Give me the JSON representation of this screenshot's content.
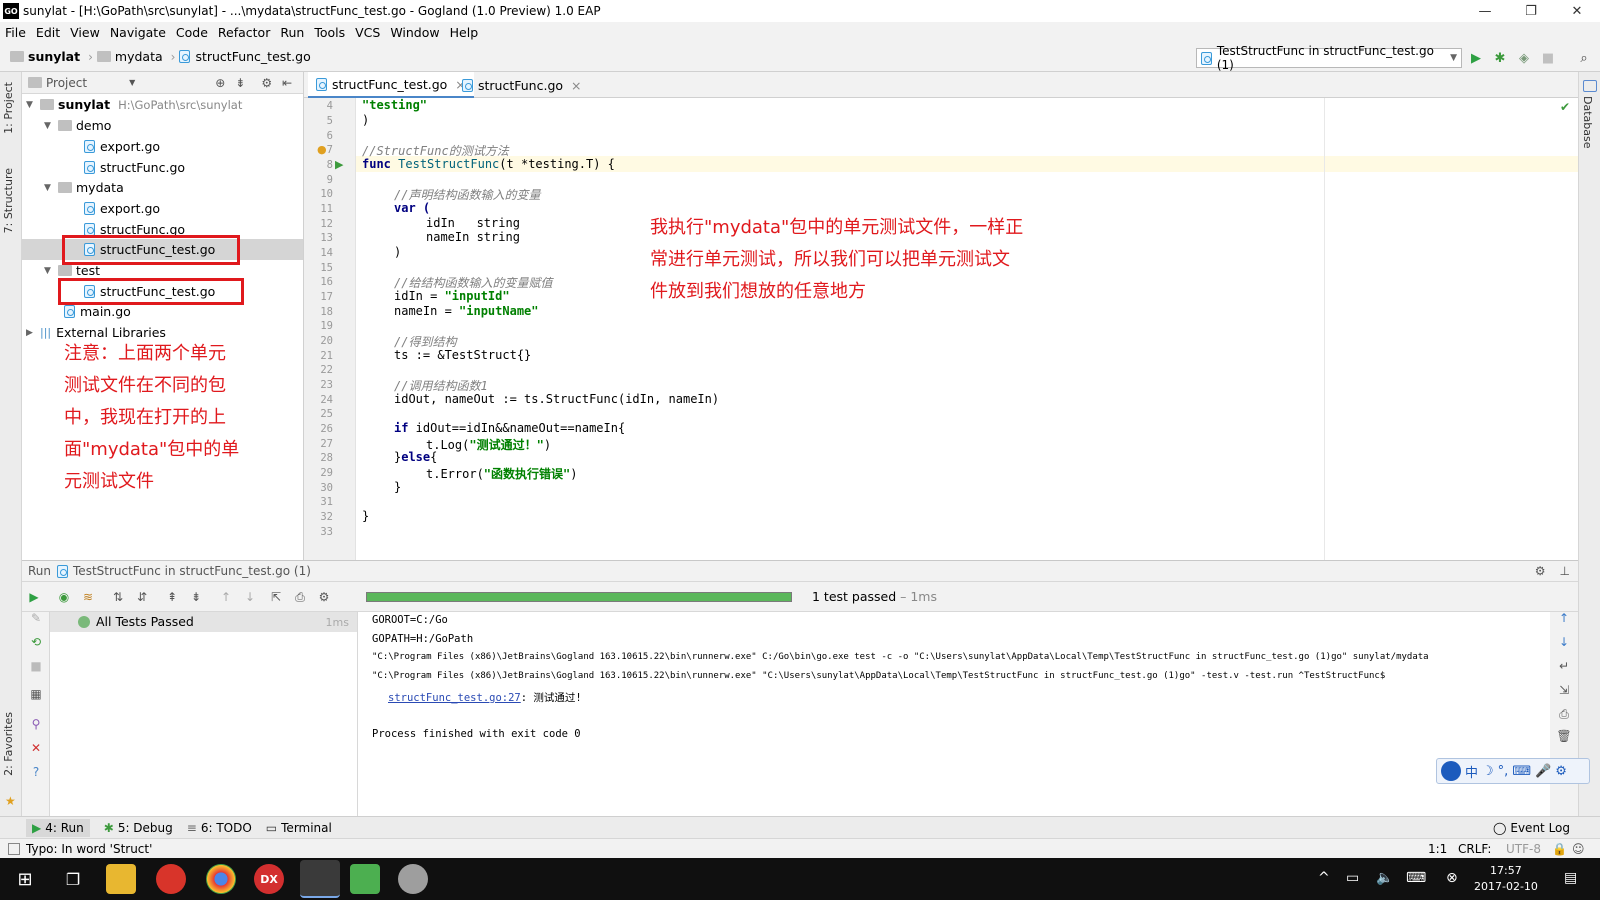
{
  "window": {
    "title": "sunylat - [H:\\GoPath\\src\\sunylat] - ...\\mydata\\structFunc_test.go - Gogland (1.0 Preview) 1.0 EAP",
    "app_icon": "GO"
  },
  "menu": [
    "File",
    "Edit",
    "View",
    "Navigate",
    "Code",
    "Refactor",
    "Run",
    "Tools",
    "VCS",
    "Window",
    "Help"
  ],
  "breadcrumb": {
    "project": "sunylat",
    "folder": "mydata",
    "file": "structFunc_test.go"
  },
  "run_config": {
    "label": "TestStructFunc in structFunc_test.go (1)"
  },
  "side_tabs": {
    "left_top": "1: Project",
    "left_mid": "7: Structure",
    "left_bottom": "2: Favorites",
    "right": "Database"
  },
  "project_panel": {
    "title": "Project",
    "tree": [
      {
        "label": "sunylat",
        "path": "H:\\GoPath\\src\\sunylat"
      },
      {
        "label": "demo"
      },
      {
        "label": "export.go"
      },
      {
        "label": "structFunc.go"
      },
      {
        "label": "mydata"
      },
      {
        "label": "export.go"
      },
      {
        "label": "structFunc.go"
      },
      {
        "label": "structFunc_test.go"
      },
      {
        "label": "test"
      },
      {
        "label": "structFunc_test.go"
      },
      {
        "label": "main.go"
      },
      {
        "label": "External Libraries"
      }
    ]
  },
  "annotations": {
    "left_note": [
      "注意：上面两个单元",
      "测试文件在不同的包",
      "中，我现在打开的上",
      "面\"mydata\"包中的单",
      "元测试文件"
    ],
    "right_note": [
      "我执行\"mydata\"包中的单元测试文件，一样正",
      "常进行单元测试，所以我们可以把单元测试文",
      "件放到我们想放的任意地方"
    ]
  },
  "editor": {
    "tabs": [
      "structFunc_test.go",
      "structFunc.go"
    ],
    "line_numbers": [
      "4",
      "5",
      "6",
      "7",
      "8",
      "9",
      "10",
      "11",
      "12",
      "13",
      "14",
      "15",
      "16",
      "17",
      "18",
      "19",
      "20",
      "21",
      "22",
      "23",
      "24",
      "25",
      "26",
      "27",
      "28",
      "29",
      "30",
      "31",
      "32",
      "33"
    ],
    "code": {
      "l4": "\"testing\"",
      "l5": ")",
      "l7": "//StructFunc的测试方法",
      "l8a": "func",
      "l8b": "TestStructFunc",
      "l8c": "(t *testing.T) {",
      "l10": "//声明结构函数输入的变量",
      "l11": "var (",
      "l12": "idIn   string",
      "l13": "nameIn string",
      "l14": ")",
      "l16": "//给结构函数输入的变量赋值",
      "l17a": "idIn = ",
      "l17b": "\"inputId\"",
      "l18a": "nameIn = ",
      "l18b": "\"inputName\"",
      "l20": "//得到结构",
      "l21": "ts := &TestStruct{}",
      "l23": "//调用结构函数1",
      "l24": "idOut, nameOut := ts.StructFunc(idIn, nameIn)",
      "l26a": "if",
      "l26b": " idOut==idIn&&nameOut==nameIn{",
      "l27a": "t.Log(",
      "l27b": "\"测试通过！\"",
      "l27c": ")",
      "l28a": "}",
      "l28b": "else",
      "l28c": "{",
      "l29a": "t.Error(",
      "l29b": "\"函数执行错误\"",
      "l29c": ")",
      "l30": "}",
      "l32": "}"
    }
  },
  "run_panel": {
    "header": "Run",
    "config": "TestStructFunc in structFunc_test.go (1)",
    "progress": 1.0,
    "result": "1 test passed",
    "duration": " – 1ms",
    "tree_item": "All Tests Passed",
    "tree_time": "1ms",
    "console": [
      "GOROOT=C:/Go",
      "GOPATH=H:/GoPath",
      "\"C:\\Program Files (x86)\\JetBrains\\Gogland 163.10615.22\\bin\\runnerw.exe\" C:/Go\\bin\\go.exe test -c -o \"C:\\Users\\sunylat\\AppData\\Local\\Temp\\TestStructFunc in structFunc_test.go (1)go\" sunylat/mydata",
      "\"C:\\Program Files (x86)\\JetBrains\\Gogland 163.10615.22\\bin\\runnerw.exe\" \"C:\\Users\\sunylat\\AppData\\Local\\Temp\\TestStructFunc in structFunc_test.go (1)go\" -test.v -test.run ^TestStructFunc$",
      "structFunc_test.go:27",
      ": 测试通过!",
      "Process finished with exit code 0"
    ]
  },
  "bottom_tabs": [
    {
      "label": "4: Run"
    },
    {
      "label": "5: Debug"
    },
    {
      "label": "6: TODO"
    },
    {
      "label": "Terminal"
    }
  ],
  "event_log": "Event Log",
  "status": {
    "message": "Typo: In word 'Struct'",
    "position": "1:1",
    "line_sep": "CRLF:",
    "encoding": "UTF-8"
  },
  "taskbar": {
    "time": "17:57",
    "date": "2017-02-10"
  },
  "ime": {
    "label": "中"
  },
  "colors": {
    "annotation": "#e0191d",
    "progress": "#5bb75b",
    "keyword": "#000080",
    "string": "#008000",
    "comment": "#808080"
  }
}
